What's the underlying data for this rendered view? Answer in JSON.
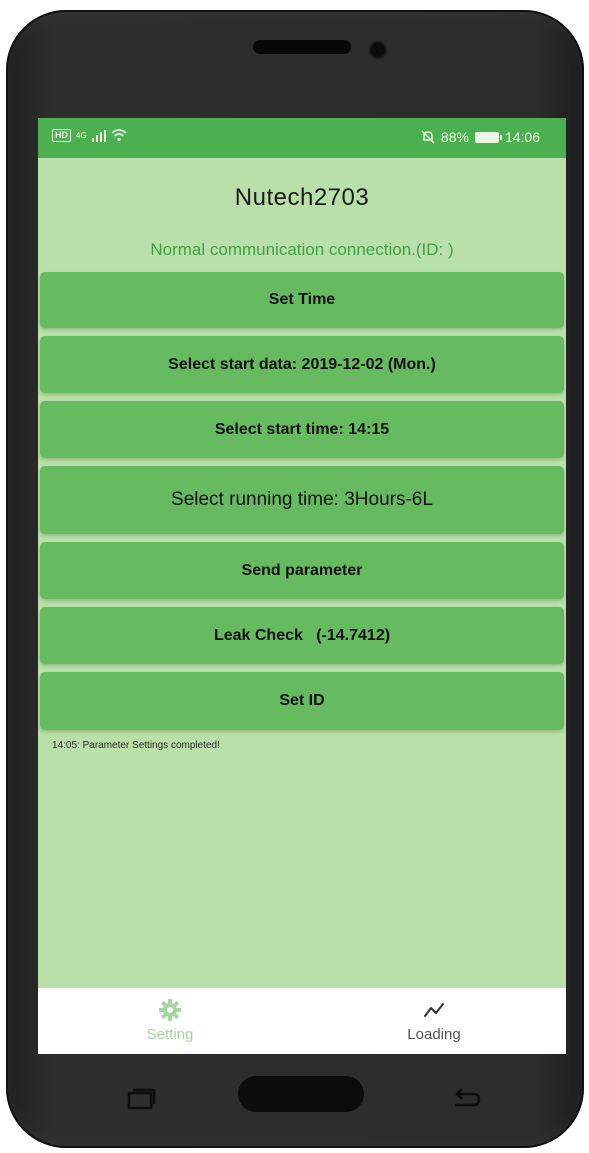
{
  "status_bar": {
    "hd": "HD",
    "signal": "4G",
    "battery_percent": "88%",
    "time": "14:06"
  },
  "app": {
    "title": "Nutech2703",
    "connection_status": "Normal communication connection.(ID: )"
  },
  "buttons": {
    "set_time": "Set Time",
    "start_date": "Select start data: 2019-12-02 (Mon.)",
    "start_time": "Select start time: 14:15",
    "running_time": "Select running time: 3Hours-6L",
    "send_parameter": "Send parameter",
    "leak_check": "Leak Check   (-14.7412)",
    "set_id": "Set ID"
  },
  "log": {
    "message": "14:05: Parameter Settings completed!"
  },
  "bottom_nav": {
    "items": [
      {
        "label": "Setting",
        "icon": "gear-icon",
        "active": true
      },
      {
        "label": "Loading",
        "icon": "trend-line-icon",
        "active": false
      }
    ]
  },
  "colors": {
    "status_bar": "#4caf50",
    "screen_background": "#b8e0a8",
    "button": "#66bb60",
    "connection_text": "#43a047"
  }
}
